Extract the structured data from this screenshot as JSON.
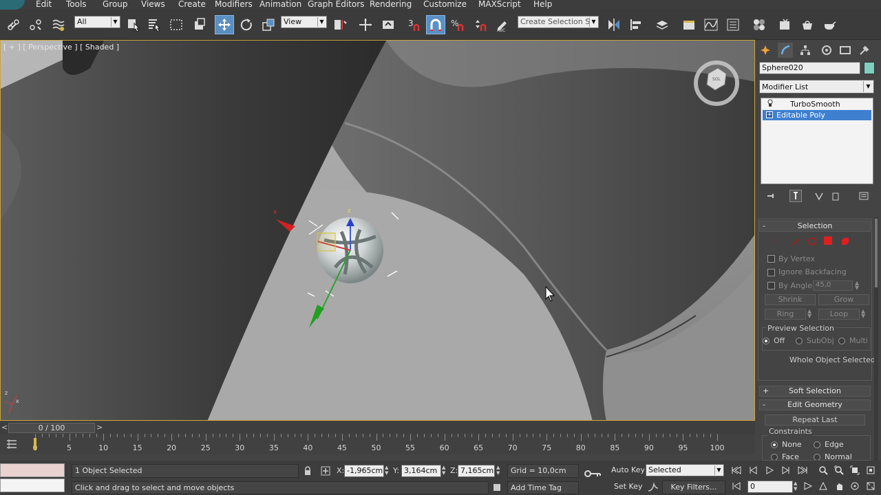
{
  "menu": {
    "items": [
      "Edit",
      "Tools",
      "Group",
      "Views",
      "Create",
      "Modifiers",
      "Animation",
      "Graph Editors",
      "Rendering",
      "Customize",
      "MAXScript",
      "Help"
    ]
  },
  "toolbar": {
    "selection_filter": "All",
    "ref_coord": "View",
    "named_selection_placeholder": "Create Selection Se",
    "icons": [
      "link-icon",
      "unlink-icon",
      "bind-spacewarp-icon",
      "select-object-icon",
      "select-by-name-icon",
      "rect-region-icon",
      "window-crossing-icon",
      "select-move-icon",
      "select-rotate-icon",
      "select-scale-icon",
      "pivot-center-icon",
      "manipulate-icon",
      "keyboard-shortcut-icon",
      "snaps-3d-icon",
      "angle-snap-icon",
      "percent-snap-icon",
      "spinner-snap-icon",
      "edit-named-sets-icon",
      "mirror-icon",
      "align-icon",
      "layer-manager-icon",
      "scene-explorer-icon",
      "curve-editor-icon",
      "schematic-view-icon",
      "material-editor-icon",
      "render-setup-icon",
      "rendered-frame-icon",
      "render-icon"
    ]
  },
  "viewport": {
    "label_parts": [
      "[ + ]",
      "[ Perspective ]",
      "[ Shaded ]"
    ]
  },
  "command_panel": {
    "object_name": "Sphere020",
    "object_color": "#7ecfc0",
    "modifier_list": "Modifier List",
    "stack": [
      {
        "label": "TurboSmooth",
        "selected": false
      },
      {
        "label": "Editable Poly",
        "selected": true
      }
    ],
    "selection": {
      "title": "Selection",
      "by_vertex": "By Vertex",
      "ignore_backfacing": "Ignore Backfacing",
      "by_angle": "By Angle:",
      "angle_value": "45,0",
      "shrink": "Shrink",
      "grow": "Grow",
      "ring": "Ring",
      "loop": "Loop",
      "preview_selection": "Preview Selection",
      "preview_off": "Off",
      "preview_subobj": "SubObj",
      "preview_multi": "Multi",
      "status": "Whole Object Selected"
    },
    "soft_selection": "Soft Selection",
    "edit_geometry": {
      "title": "Edit Geometry",
      "repeat_last": "Repeat Last",
      "constraints": "Constraints",
      "none": "None",
      "edge": "Edge",
      "face": "Face",
      "normal": "Normal"
    }
  },
  "timeline": {
    "frame_display": "0 / 100",
    "prev": "<",
    "next": ">",
    "ticks": [
      "0",
      "5",
      "10",
      "15",
      "20",
      "25",
      "30",
      "35",
      "40",
      "45",
      "50",
      "55",
      "60",
      "65",
      "70",
      "75",
      "80",
      "85",
      "90",
      "95",
      "100"
    ]
  },
  "status": {
    "selection_count": "1 Object Selected",
    "prompt": "Click and drag to select and move objects",
    "x_label": "X:",
    "x_value": "-1,965cm",
    "y_label": "Y:",
    "y_value": "3,164cm",
    "z_label": "Z:",
    "z_value": "7,165cm",
    "grid": "Grid = 10,0cm",
    "add_time_tag": "Add Time Tag",
    "auto_key": "Auto Key",
    "set_key": "Set Key",
    "key_mode": "Selected",
    "key_filters": "Key Filters...",
    "current_frame": "0"
  }
}
